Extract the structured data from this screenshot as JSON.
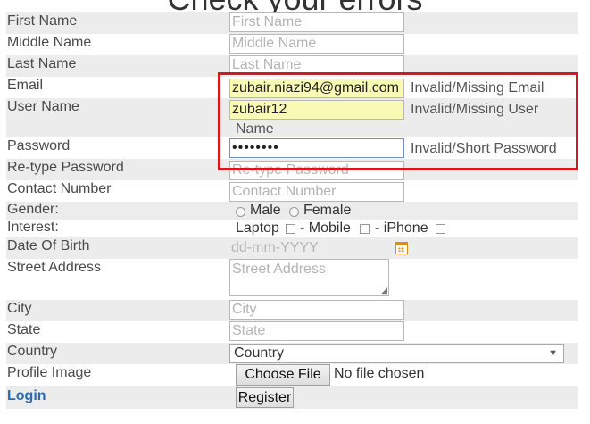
{
  "page": {
    "heading": "Check your errors",
    "accent_error_color": "#d9161c"
  },
  "form": {
    "first_name": {
      "label": "First Name",
      "placeholder": "First Name"
    },
    "middle_name": {
      "label": "Middle Name",
      "placeholder": "Middle Name"
    },
    "last_name": {
      "label": "Last Name",
      "placeholder": "Last Name"
    },
    "email": {
      "label": "Email",
      "value": "zubair.niazi94@gmail.com",
      "error": "Invalid/Missing Email"
    },
    "user_name": {
      "label": "User Name",
      "value": "zubair12",
      "error_line1": "Invalid/Missing User",
      "error_line2": "Name"
    },
    "password": {
      "label": "Password",
      "value": "••••••••",
      "error": "Invalid/Short Password"
    },
    "retype_password": {
      "label": "Re-type Password",
      "placeholder": "Re-type Password"
    },
    "contact_number": {
      "label": "Contact Number",
      "placeholder": "Contact Number"
    },
    "gender": {
      "label": "Gender:",
      "options": [
        "Male",
        "Female"
      ]
    },
    "interest": {
      "label": "Interest:",
      "options": [
        "Laptop",
        "- Mobile",
        "- iPhone"
      ]
    },
    "date_of_birth": {
      "label": "Date Of Birth",
      "placeholder": "dd-mm-YYYY",
      "icon": "calendar-icon"
    },
    "street_address": {
      "label": "Street Address",
      "placeholder": "Street Address"
    },
    "city": {
      "label": "City",
      "placeholder": "City"
    },
    "state": {
      "label": "State",
      "placeholder": "State"
    },
    "country": {
      "label": "Country",
      "selected": "Country"
    },
    "profile_image": {
      "label": "Profile Image",
      "button": "Choose File",
      "status": "No file chosen"
    },
    "login_link": "Login",
    "register_button": "Register"
  }
}
